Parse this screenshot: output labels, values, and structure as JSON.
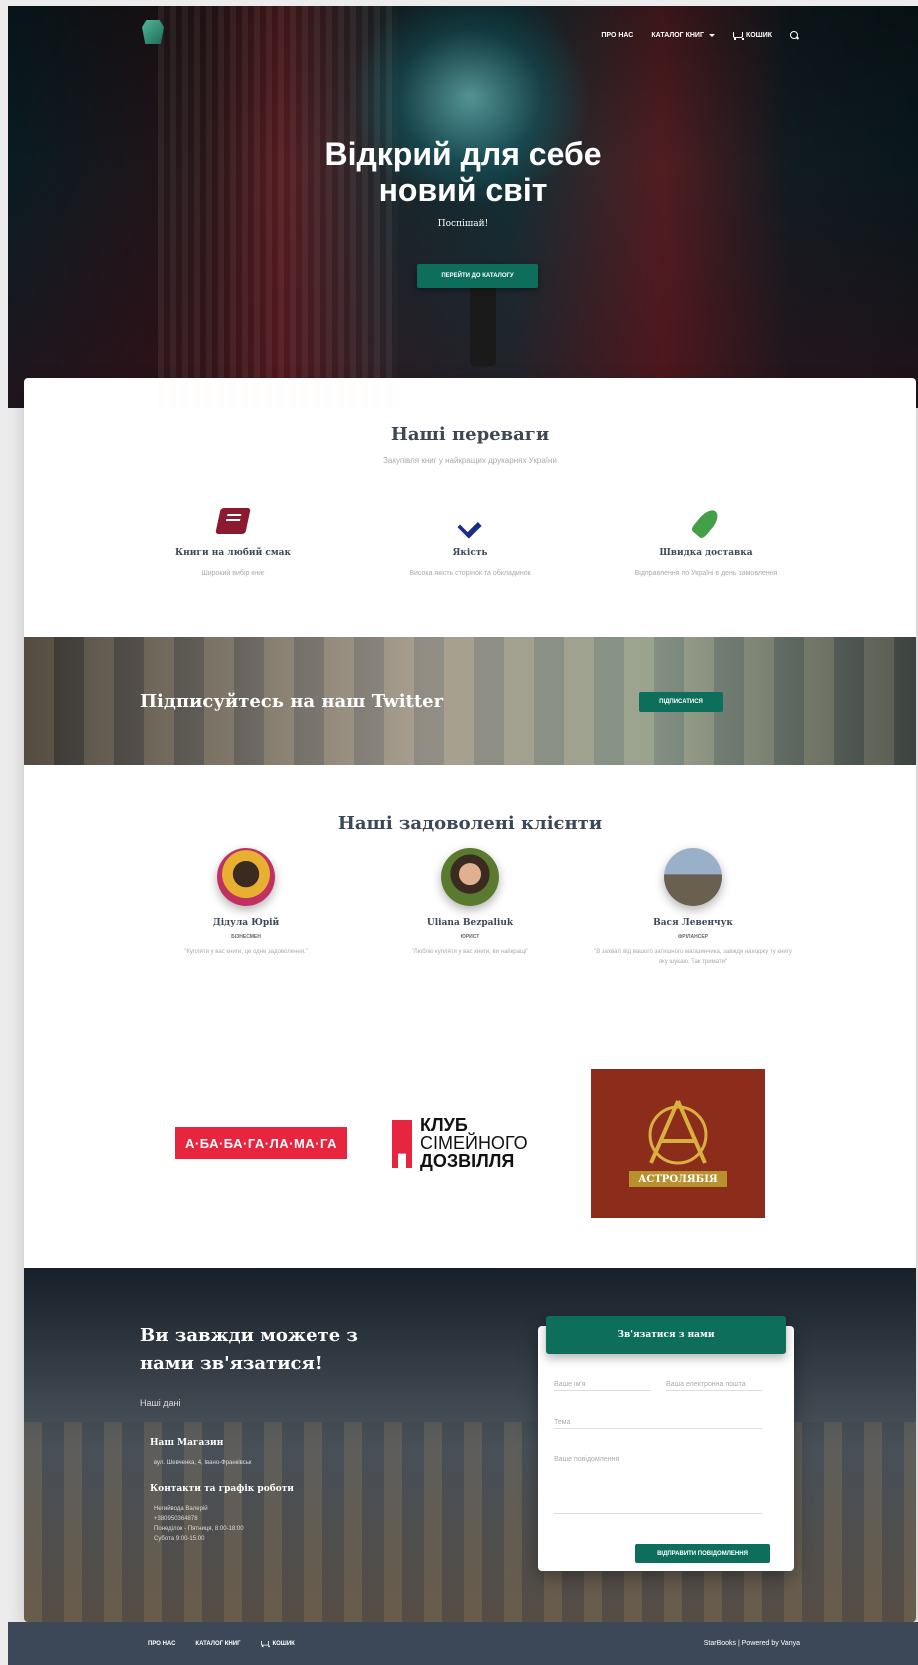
{
  "nav": {
    "items": [
      {
        "label": "ПРО НАС"
      },
      {
        "label": "КАТАЛОГ КНИГ"
      },
      {
        "label": "КОШИК"
      }
    ]
  },
  "hero": {
    "title_line1": "Відкрий для себе",
    "title_line2": "новий світ",
    "subtitle": "Поспішай!",
    "button": "ПЕРЕЙТИ ДО КАТАЛОГУ"
  },
  "advantages": {
    "title": "Наші переваги",
    "subtitle": "Закупівля книг у найкращих друкарнях України",
    "items": [
      {
        "title": "Книги на любий смак",
        "desc": "Широкий вибір книг",
        "icon": "book-icon"
      },
      {
        "title": "Якість",
        "desc": "Висока якість сторінок та обкладинок",
        "icon": "check-icon"
      },
      {
        "title": "Швидка доставка",
        "desc": "Відправлення по Україні в день замовлення",
        "icon": "rocket-icon"
      }
    ]
  },
  "twitter": {
    "title": "Підписуйтесь на наш Twitter",
    "button": "ПІДПИСАТИСЯ"
  },
  "clients": {
    "title": "Наші задоволені клієнти",
    "items": [
      {
        "name": "Дідула Юрій",
        "role": "БІЗНЕСМЕН",
        "quote": "\"Купляти у вас книги, це одне задоволення.\""
      },
      {
        "name": "Uliana Bezpaliuk",
        "role": "ЮРИСТ",
        "quote": "\"Люблю купляти у вас книги, ви найкращі\""
      },
      {
        "name": "Вася Левенчук",
        "role": "ФРІЛАНСЕР",
        "quote": "\"В захваті від вашого затишного магазинчика, завжди находжу ту книгу яку шукаю. Так тримати\""
      }
    ]
  },
  "brands": {
    "brand1": "А·БА·БА·ГА·ЛА·МА·ГА",
    "brand2_line1": "КЛУБ",
    "brand2_line2": "СІМЕЙНОГО",
    "brand2_line3": "ДОЗВІЛЛЯ",
    "brand3": "АСТРОЛЯБІЯ"
  },
  "contact": {
    "title": "Ви завжди можете з нами зв'язатися!",
    "subtitle": "Наші дані",
    "shop_heading": "Наш Магазин",
    "shop_address": "вул. Шевченка, 4, Івано-Франківськ",
    "hours_heading": "Контакти та графік роботи",
    "hours_lines": [
      "Негийвода Валерій",
      "+380950364878",
      "Понеділок - Пятниця, 8:00-18:00",
      "Субота 9:00-15:00"
    ]
  },
  "form": {
    "header": "Зв'язатися з нами",
    "name_placeholder": "Ваше ім'я",
    "email_placeholder": "Ваша електронна пошта",
    "subject_placeholder": "Тема",
    "message_placeholder": "Ваше повідомлення",
    "submit": "ВІДПРАВИТИ ПОВІДОМЛЕННЯ"
  },
  "footer": {
    "links": [
      {
        "label": "ПРО НАС"
      },
      {
        "label": "КАТАЛОГ КНИГ"
      },
      {
        "label": "КОШИК"
      }
    ],
    "copyright": "StarBooks | Powered by Vanya"
  },
  "colors": {
    "accent": "#0e6e5c",
    "dark": "#3c4858",
    "brand_red": "#e8253f"
  }
}
